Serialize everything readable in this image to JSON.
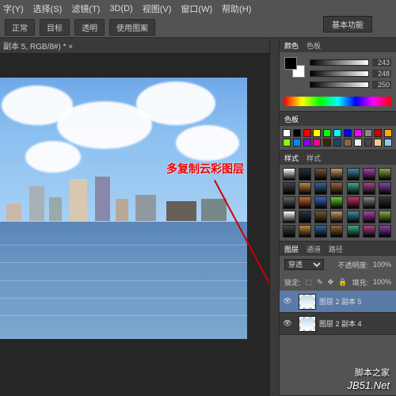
{
  "menu": {
    "items": [
      "字(Y)",
      "选择(S)",
      "滤镜(T)",
      "3D(D)",
      "视图(V)",
      "窗口(W)",
      "帮助(H)"
    ]
  },
  "workspace_label": "基本功能",
  "optionbar": {
    "items": [
      "正常",
      "目标",
      "透明",
      "使用图案"
    ]
  },
  "doc_tab": "副本 5, RGB/8#) * ×",
  "annotation_text": "多复制云彩图层",
  "color": {
    "tab1": "颜色",
    "tab2": "色板",
    "sliders": [
      {
        "label": "",
        "value": "243"
      },
      {
        "label": "",
        "value": "248"
      },
      {
        "label": "",
        "value": "250"
      }
    ]
  },
  "swatches_tab1": "色板",
  "styles_tab1": "样式",
  "styles_tab2": "样式",
  "layers": {
    "tab1": "图层",
    "tab2": "通道",
    "tab3": "路径",
    "blend": "穿透",
    "opacity_lbl": "不透明度:",
    "opacity": "100%",
    "lock_lbl": "锁定:",
    "fill_lbl": "填充:",
    "fill": "100%",
    "items": [
      {
        "name": "图层 2 副本 5",
        "visible": true,
        "selected": true
      },
      {
        "name": "图层 2 副本 4",
        "visible": true,
        "selected": false
      }
    ]
  },
  "watermark": "JB51.Net",
  "watermark_cn": "脚本之家",
  "chart_data": null
}
